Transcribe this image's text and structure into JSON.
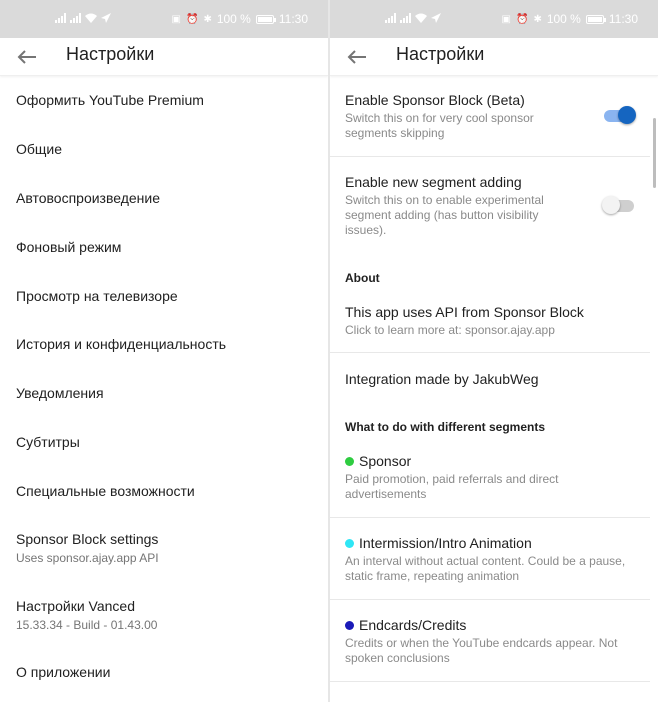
{
  "status_bar": {
    "battery": "100 %",
    "time": "11:30"
  },
  "left": {
    "title": "Настройки",
    "items": [
      {
        "label": "Оформить YouTube Premium"
      },
      {
        "label": "Общие"
      },
      {
        "label": "Автовоспроизведение"
      },
      {
        "label": "Фоновый режим"
      },
      {
        "label": "Просмотр на телевизоре"
      },
      {
        "label": "История и конфиденциальность"
      },
      {
        "label": "Уведомления"
      },
      {
        "label": "Субтитры"
      },
      {
        "label": "Специальные возможности"
      },
      {
        "label": "Sponsor Block settings",
        "sub": "Uses sponsor.ajay.app API"
      },
      {
        "label": "Настройки Vanced",
        "sub": "15.33.34 - Build - 01.43.00"
      },
      {
        "label": "О приложении"
      }
    ]
  },
  "right": {
    "title": "Настройки",
    "enable_sponsor": {
      "title": "Enable Sponsor Block (Beta)",
      "sub1": "Switch this on for very cool sponsor",
      "sub2": "segments skipping",
      "checked": true
    },
    "enable_segment": {
      "title": "Enable new segment adding",
      "sub1": "Switch this on to enable experimental",
      "sub2": "segment adding (has button visibility",
      "sub3": "issues).",
      "checked": false
    },
    "about_header": "About",
    "api": {
      "title": "This app uses API from Sponsor Block",
      "sub": "Click to learn more at: sponsor.ajay.app"
    },
    "integration": "Integration made by JakubWeg",
    "segments_header": "What to do with different segments",
    "segments": [
      {
        "title": "Sponsor",
        "color": "#2ecc40",
        "sub1": "Paid promotion, paid referrals and direct",
        "sub2": "advertisements"
      },
      {
        "title": "Intermission/Intro Animation",
        "color": "#2fe6f5",
        "sub1": "An interval without actual content. Could be a pause,",
        "sub2": "static frame, repeating animation"
      },
      {
        "title": "Endcards/Credits",
        "color": "#1a1ab8",
        "sub1": "Credits or when the YouTube endcards appear. Not",
        "sub2": "spoken conclusions"
      }
    ]
  }
}
